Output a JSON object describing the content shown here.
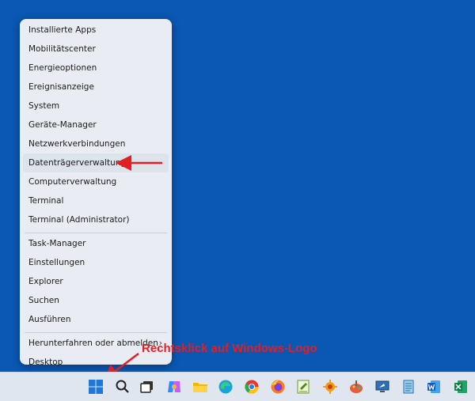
{
  "context_menu": {
    "items": [
      {
        "label": "Installierte Apps"
      },
      {
        "label": "Mobilitätscenter"
      },
      {
        "label": "Energieoptionen"
      },
      {
        "label": "Ereignisanzeige"
      },
      {
        "label": "System"
      },
      {
        "label": "Geräte-Manager"
      },
      {
        "label": "Netzwerkverbindungen"
      },
      {
        "label": "Datenträgerverwaltung"
      },
      {
        "label": "Computerverwaltung"
      },
      {
        "label": "Terminal"
      },
      {
        "label": "Terminal (Administrator)"
      },
      {
        "label": "Task-Manager"
      },
      {
        "label": "Einstellungen"
      },
      {
        "label": "Explorer"
      },
      {
        "label": "Suchen"
      },
      {
        "label": "Ausführen"
      },
      {
        "label": "Herunterfahren oder abmelden"
      },
      {
        "label": "Desktop"
      }
    ],
    "submenu_glyph": "›"
  },
  "annotation": {
    "text": "Rechtsklick auf Windows-Logo",
    "color": "#e31e24"
  },
  "taskbar": {
    "icons": [
      "windows-start-icon",
      "search-icon",
      "task-view-icon",
      "copilot-icon",
      "file-explorer-icon",
      "edge-icon",
      "chrome-icon",
      "firefox-icon",
      "notepad-plus-icon",
      "settings-sun-icon",
      "paint-icon",
      "remote-desktop-icon",
      "notepad-icon",
      "word-icon",
      "excel-icon"
    ]
  },
  "colors": {
    "desktop_background": "#0a58b3",
    "menu_background": "#e9edf3",
    "taskbar_background": "#dfe6ef"
  }
}
